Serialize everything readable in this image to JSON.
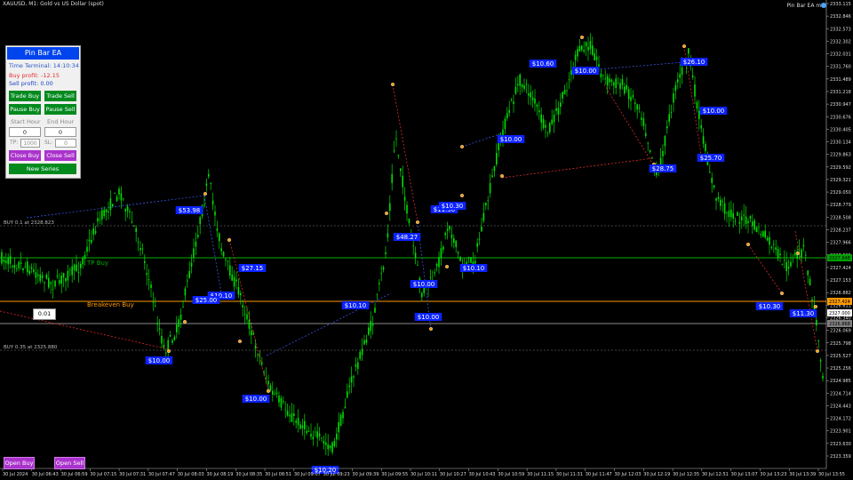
{
  "window": {
    "symbol": "XAUUSD, M1: Gold vs US Dollar (spot)",
    "ea_name": "Pin Bar EA m5"
  },
  "panel": {
    "title": "Pin Bar EA",
    "time_terminal": "Time Terminal: 14:10:34",
    "buy_profit": "Buy profit: -12.15",
    "sell_profit": "Sell profit: 0.00",
    "trade_buy": "Trade Buy",
    "trade_sell": "Trade Sell",
    "pause_buy": "Pause Buy",
    "pause_sell": "Pause Sell",
    "start_hour_label": "Start Hour",
    "end_hour_label": "End Hour",
    "start_hour_value": "0",
    "end_hour_value": "0",
    "tp_label": "TP:",
    "tp_value": "1000",
    "sl_label": "SL:",
    "sl_value": "0",
    "close_buy": "Close Buy",
    "close_sell": "Close Sell",
    "new_series": "New Series"
  },
  "lot_value": "0.01",
  "open_buy": "Open Buy",
  "open_sell": "Open Sell",
  "lines": {
    "tp_buy_label": "TP Buy",
    "breakeven_label": "Breakeven Buy",
    "buy_order_1": "BUY 0.1 at 2328.823",
    "buy_order_2": "BUY 0.35 at 2325.880"
  },
  "colors": {
    "candle": "#00e000",
    "tp_line": "#00b000",
    "breakeven_line": "#ff9a00",
    "order_line": "#808080",
    "profit_label": "#0b22ff",
    "panel_header": "#0044ee",
    "button_green": "#008a1e",
    "button_purple": "#aa33cc"
  },
  "chart_data": {
    "type": "candlestick",
    "symbol": "XAUUSD",
    "timeframe": "M1",
    "y_ticks": [
      "2333.115",
      "2332.846",
      "2332.573",
      "2332.302",
      "2332.031",
      "2331.760",
      "2331.489",
      "2331.218",
      "2330.947",
      "2330.676",
      "2330.405",
      "2330.134",
      "2329.863",
      "2329.592",
      "2329.321",
      "2329.050",
      "2328.779",
      "2328.508",
      "2328.237",
      "2327.966",
      "2327.695",
      "2327.424",
      "2327.153",
      "2326.882",
      "2326.611",
      "2326.340",
      "2326.069",
      "2325.798",
      "2325.527",
      "2325.256",
      "2324.985",
      "2324.714",
      "2324.443",
      "2324.172",
      "2323.901",
      "2323.630",
      "2323.359"
    ],
    "x_ticks": [
      "30 Jul 2024",
      "30 Jul 06:43",
      "30 Jul 06:59",
      "30 Jul 07:15",
      "30 Jul 07:31",
      "30 Jul 07:47",
      "30 Jul 08:03",
      "30 Jul 08:19",
      "30 Jul 08:35",
      "30 Jul 08:51",
      "30 Jul 09:07",
      "30 Jul 09:23",
      "30 Jul 09:39",
      "30 Jul 09:55",
      "30 Jul 10:11",
      "30 Jul 10:27",
      "30 Jul 10:43",
      "30 Jul 10:59",
      "30 Jul 11:15",
      "30 Jul 11:31",
      "30 Jul 11:47",
      "30 Jul 12:03",
      "30 Jul 12:19",
      "30 Jul 12:35",
      "30 Jul 12:51",
      "30 Jul 13:07",
      "30 Jul 13:23",
      "30 Jul 13:39",
      "30 Jul 13:55"
    ],
    "price_flags": [
      {
        "text": "2327.848",
        "color": "#00a000"
      },
      {
        "text": "2327.424",
        "color": "#ff9a00"
      },
      {
        "text": "2327.000",
        "color": "#ffffff"
      },
      {
        "text": "2326.868",
        "color": "#808080"
      }
    ],
    "profit_labels": [
      "$53.98",
      "$27.15",
      "$10.10",
      "$25.00",
      "$10.00",
      "$10.00",
      "$10.10",
      "$10.00",
      "$10.00",
      "$48.27",
      "$11.50",
      "$10.30",
      "$10.10",
      "$10.00",
      "$10.60",
      "$10.00",
      "$26.10",
      "$10.00",
      "$28.75",
      "$25.70",
      "$10.30",
      "$11.30",
      "$10.20"
    ],
    "grid": false
  }
}
